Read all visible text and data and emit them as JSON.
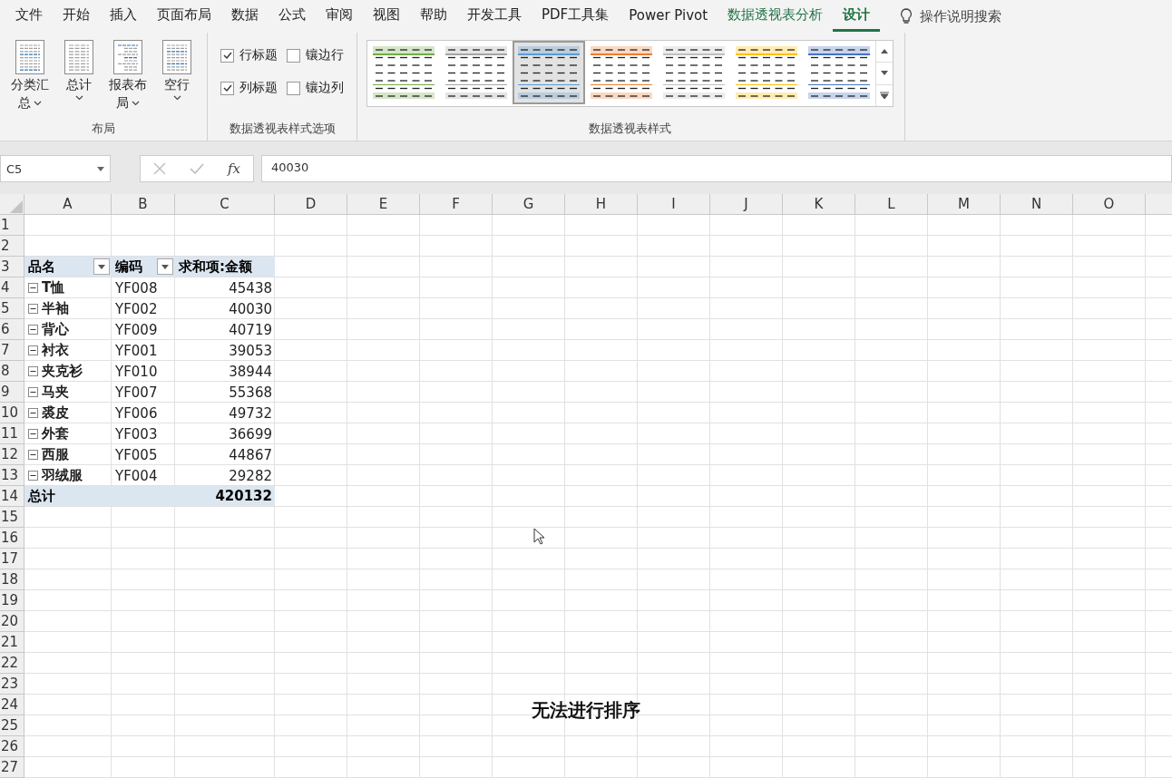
{
  "tabs": [
    {
      "label": "文件",
      "kind": "normal",
      "selected": false
    },
    {
      "label": "开始",
      "kind": "normal",
      "selected": false
    },
    {
      "label": "插入",
      "kind": "normal",
      "selected": false
    },
    {
      "label": "页面布局",
      "kind": "normal",
      "selected": false
    },
    {
      "label": "数据",
      "kind": "normal",
      "selected": false
    },
    {
      "label": "公式",
      "kind": "normal",
      "selected": false
    },
    {
      "label": "审阅",
      "kind": "normal",
      "selected": false
    },
    {
      "label": "视图",
      "kind": "normal",
      "selected": false
    },
    {
      "label": "帮助",
      "kind": "normal",
      "selected": false
    },
    {
      "label": "开发工具",
      "kind": "normal",
      "selected": false
    },
    {
      "label": "PDF工具集",
      "kind": "normal",
      "selected": false
    },
    {
      "label": "Power Pivot",
      "kind": "normal",
      "selected": false
    },
    {
      "label": "数据透视表分析",
      "kind": "contextual",
      "selected": false
    },
    {
      "label": "设计",
      "kind": "contextual",
      "selected": true
    }
  ],
  "tell_me": "操作说明搜索",
  "ribbon": {
    "layout_group": {
      "title": "布局",
      "buttons": [
        {
          "lines": [
            "分类汇",
            "总"
          ]
        },
        {
          "lines": [
            "总计"
          ]
        },
        {
          "lines": [
            "报表布",
            "局"
          ]
        },
        {
          "lines": [
            "空行"
          ]
        }
      ]
    },
    "style_options": {
      "title": "数据透视表样式选项",
      "items": [
        {
          "label": "行标题",
          "checked": true
        },
        {
          "label": "镶边行",
          "checked": false
        },
        {
          "label": "列标题",
          "checked": true
        },
        {
          "label": "镶边列",
          "checked": false
        }
      ]
    },
    "styles": {
      "title": "数据透视表样式",
      "items": [
        {
          "color": "#70ad47",
          "selected": false
        },
        {
          "color": "#a5a5a5",
          "selected": false
        },
        {
          "color": "#5b9bd5",
          "selected": true
        },
        {
          "color": "#ed7d31",
          "selected": false
        },
        {
          "color": "#bfbfbf",
          "selected": false
        },
        {
          "color": "#ffc000",
          "selected": false
        },
        {
          "color": "#4472c4",
          "selected": false
        }
      ]
    }
  },
  "formula_bar": {
    "name_box": "C5",
    "function_label": "fx",
    "value": "40030"
  },
  "sheet": {
    "columns": [
      "A",
      "B",
      "C",
      "D",
      "E",
      "F",
      "G",
      "H",
      "I",
      "J",
      "K",
      "L",
      "M",
      "N",
      "O"
    ],
    "rows": [
      "1",
      "2",
      "3",
      "4",
      "5",
      "6",
      "7",
      "8",
      "9",
      "10",
      "11",
      "12",
      "13",
      "14",
      "15",
      "16",
      "17",
      "18",
      "19",
      "20",
      "21",
      "22",
      "23",
      "24",
      "25",
      "26",
      "27"
    ],
    "pivot": {
      "headers": [
        {
          "label": "品名",
          "filter": true
        },
        {
          "label": "编码",
          "filter": true
        },
        {
          "label": "求和项:金额",
          "filter": false
        }
      ],
      "rows": [
        {
          "name": "T恤",
          "code": "YF008",
          "amount": "45438",
          "expanded": true
        },
        {
          "name": "半袖",
          "code": "YF002",
          "amount": "40030",
          "expanded": true
        },
        {
          "name": "背心",
          "code": "YF009",
          "amount": "40719",
          "expanded": true
        },
        {
          "name": "衬衣",
          "code": "YF001",
          "amount": "39053",
          "expanded": true
        },
        {
          "name": "夹克衫",
          "code": "YF010",
          "amount": "38944",
          "expanded": true
        },
        {
          "name": "马夹",
          "code": "YF007",
          "amount": "55368",
          "expanded": true
        },
        {
          "name": "裘皮",
          "code": "YF006",
          "amount": "49732",
          "expanded": true
        },
        {
          "name": "外套",
          "code": "YF003",
          "amount": "36699",
          "expanded": true
        },
        {
          "name": "西服",
          "code": "YF005",
          "amount": "44867",
          "expanded": true
        },
        {
          "name": "羽绒服",
          "code": "YF004",
          "amount": "29282",
          "expanded": true
        }
      ],
      "total": {
        "label": "总计",
        "value": "420132"
      }
    }
  },
  "subtitle": "无法进行排序"
}
